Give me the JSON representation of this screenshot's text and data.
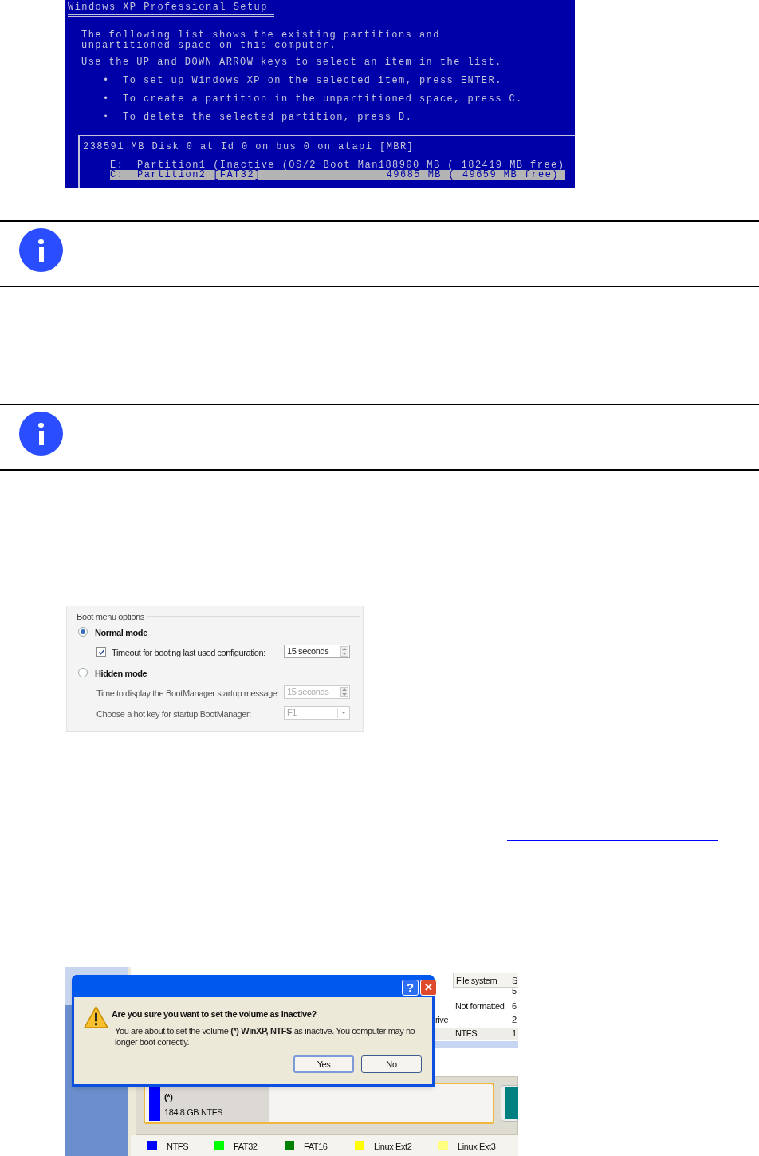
{
  "setup_screen": {
    "title": "Windows XP Professional Setup",
    "intro": "The following list shows the existing partitions and\nunpartitioned space on this computer.",
    "instruction": "Use the UP and DOWN ARROW keys to select an item in the list.",
    "bullets": [
      "To set up Windows XP on the selected item, press ENTER.",
      "To create a partition in the unpartitioned space, press C.",
      "To delete the selected partition, press D."
    ],
    "bullet_mark": "•",
    "disk": "238591 MB Disk 0 at Id 0 on bus 0 on atapi [MBR]",
    "partitions": [
      {
        "drive": "E:",
        "name": "Partition1 (Inactive (OS/2 Boot Man",
        "size": "188900 MB ( 182419 MB free)",
        "selected": false
      },
      {
        "drive": "C:",
        "name": "Partition2 [FAT32]",
        "size": "49685 MB ( 49659 MB free)",
        "selected": true
      }
    ]
  },
  "notes": [
    {
      "kind": "info"
    },
    {
      "kind": "info"
    }
  ],
  "boot_menu": {
    "title": "Boot menu options",
    "modes": [
      {
        "label": "Normal mode",
        "selected": true,
        "settings": [
          {
            "kind": "spinner",
            "label": "Timeout for booting last used configuration:",
            "value": "15 seconds",
            "checked": true,
            "disabled": false
          }
        ]
      },
      {
        "label": "Hidden mode",
        "selected": false,
        "settings": [
          {
            "kind": "spinner",
            "label": "Time to display the BootManager startup message:",
            "value": "15 seconds",
            "disabled": true
          },
          {
            "kind": "dropdown",
            "label": "Choose a hot key for startup BootManager:",
            "value": "F1",
            "disabled": true
          }
        ]
      }
    ]
  },
  "link_underline": true,
  "inactive_dialog": {
    "background": {
      "header": [
        "File system",
        "S"
      ],
      "cells": [
        {
          "text": "5",
          "kind": "size"
        },
        {
          "text": "Not formatted",
          "kind": "fs"
        },
        {
          "text": "6",
          "kind": "size"
        },
        {
          "text": "rive",
          "kind": "name"
        },
        {
          "text": "2",
          "kind": "size"
        },
        {
          "text": "NTFS",
          "kind": "fs"
        },
        {
          "text": "1",
          "kind": "size"
        }
      ],
      "volume": {
        "label": "(*)",
        "detail": "184.8 GB NTFS",
        "color": "#0000ff"
      },
      "legend": [
        {
          "label": "NTFS",
          "color": "#0000ff"
        },
        {
          "label": "FAT32",
          "color": "#00ff00"
        },
        {
          "label": "FAT16",
          "color": "#008000"
        },
        {
          "label": "Linux Ext2",
          "color": "#ffff00"
        },
        {
          "label": "Linux Ext3",
          "color": "#ffff80"
        }
      ]
    },
    "help": "?",
    "close": "✕",
    "question": "Are you sure you want to set the volume as inactive?",
    "message": "You are about to set the volume **(*) WinXP, NTFS** as inactive. You computer may no longer boot correctly.",
    "buttons": [
      {
        "label": "Yes",
        "selected": true
      },
      {
        "label": "No",
        "selected": false
      }
    ]
  }
}
